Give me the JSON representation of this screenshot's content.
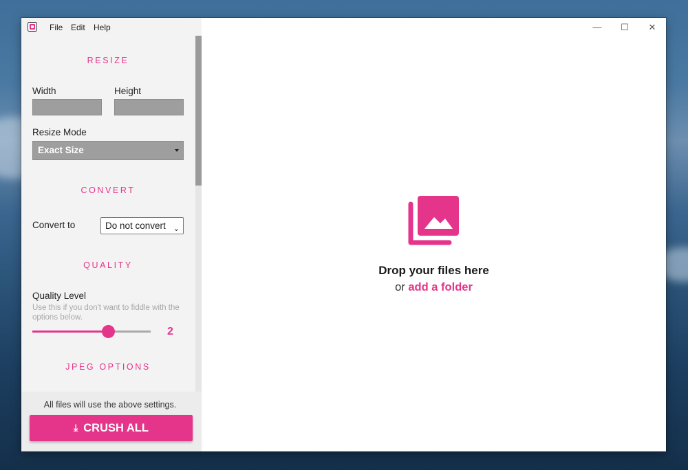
{
  "menu": {
    "items": [
      "File",
      "Edit",
      "Help"
    ]
  },
  "window_controls": {
    "minimize": "—",
    "maximize": "☐",
    "close": "✕"
  },
  "resize": {
    "title": "RESIZE",
    "width_label": "Width",
    "height_label": "Height",
    "width_value": "",
    "height_value": "",
    "mode_label": "Resize Mode",
    "mode_value": "Exact Size"
  },
  "convert": {
    "title": "CONVERT",
    "label": "Convert to",
    "value": "Do not convert"
  },
  "quality": {
    "title": "QUALITY",
    "label": "Quality Level",
    "hint": "Use this if you don't want to fiddle with the options below.",
    "value": "2",
    "slider_fraction": 0.64
  },
  "jpeg": {
    "title": "JPEG OPTIONS"
  },
  "footer": {
    "note": "All files will use the above settings.",
    "button_label": "CRUSH ALL"
  },
  "dropzone": {
    "title": "Drop your files here",
    "prefix": "or",
    "link": "add a folder"
  },
  "colors": {
    "accent": "#e5358a",
    "sidebar": "#f3f3f3",
    "input_gray": "#9e9e9e"
  }
}
